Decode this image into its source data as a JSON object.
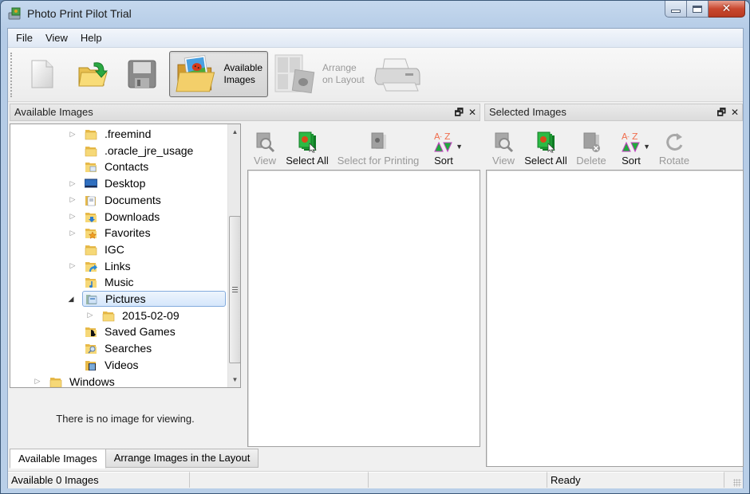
{
  "window": {
    "title": "Photo Print Pilot Trial",
    "controls": {
      "minimize": "minimize",
      "maximize": "maximize",
      "close": "✕"
    }
  },
  "menu": {
    "items": [
      "File",
      "View",
      "Help"
    ]
  },
  "toolbar": {
    "buttons": [
      {
        "id": "new",
        "icon": "new-document-icon",
        "label": ""
      },
      {
        "id": "open",
        "icon": "open-folder-icon",
        "label": ""
      },
      {
        "id": "save",
        "icon": "floppy-disk-icon",
        "label": ""
      },
      {
        "id": "available-images",
        "icon": "folder-image-icon",
        "label_line1": "Available",
        "label_line2": "Images",
        "pressed": true
      },
      {
        "id": "arrange-on-layout",
        "icon": "layout-icon",
        "label_line1": "Arrange",
        "label_line2": "on Layout",
        "disabled": true
      },
      {
        "id": "print",
        "icon": "printer-icon",
        "label": "",
        "disabled": true
      }
    ]
  },
  "available_pane": {
    "title": "Available Images",
    "float_glyph": "🗗",
    "close_glyph": "✕",
    "tree": [
      {
        "label": ".freemind",
        "level": 2,
        "expander": "closed",
        "icon": "folder"
      },
      {
        "label": ".oracle_jre_usage",
        "level": 2,
        "expander": "none",
        "icon": "folder"
      },
      {
        "label": "Contacts",
        "level": 2,
        "expander": "none",
        "icon": "contacts"
      },
      {
        "label": "Desktop",
        "level": 2,
        "expander": "closed",
        "icon": "desktop"
      },
      {
        "label": "Documents",
        "level": 2,
        "expander": "closed",
        "icon": "documents"
      },
      {
        "label": "Downloads",
        "level": 2,
        "expander": "closed",
        "icon": "downloads"
      },
      {
        "label": "Favorites",
        "level": 2,
        "expander": "closed",
        "icon": "favorites"
      },
      {
        "label": "IGC",
        "level": 2,
        "expander": "none",
        "icon": "folder"
      },
      {
        "label": "Links",
        "level": 2,
        "expander": "closed",
        "icon": "links"
      },
      {
        "label": "Music",
        "level": 2,
        "expander": "none",
        "icon": "music"
      },
      {
        "label": "Pictures",
        "level": 2,
        "expander": "open",
        "icon": "pictures",
        "selected": true
      },
      {
        "label": "2015-02-09",
        "level": 3,
        "expander": "closed",
        "icon": "folder"
      },
      {
        "label": "Saved Games",
        "level": 2,
        "expander": "none",
        "icon": "saved-games"
      },
      {
        "label": "Searches",
        "level": 2,
        "expander": "none",
        "icon": "searches"
      },
      {
        "label": "Videos",
        "level": 2,
        "expander": "none",
        "icon": "videos"
      },
      {
        "label": "Windows",
        "level": 0,
        "expander": "closed",
        "icon": "folder"
      }
    ],
    "preview_message": "There is no image for viewing.",
    "tabs": [
      "Available Images",
      "Arrange Images in the Layout"
    ],
    "active_tab": 0
  },
  "middle_pane": {
    "buttons": [
      {
        "label": "View",
        "icon": "view-magnifier-icon",
        "disabled": true
      },
      {
        "label": "Select All",
        "icon": "select-all-icon",
        "disabled": false
      },
      {
        "label": "Select for Printing",
        "icon": "select-for-printing-icon",
        "disabled": true
      },
      {
        "label": "Sort",
        "icon": "sort-az-icon",
        "disabled": false,
        "dropdown": true
      }
    ]
  },
  "selected_pane": {
    "title": "Selected Images",
    "float_glyph": "🗗",
    "close_glyph": "✕",
    "buttons": [
      {
        "label": "View",
        "icon": "view-magnifier-icon",
        "disabled": true
      },
      {
        "label": "Select All",
        "icon": "select-all-icon",
        "disabled": false
      },
      {
        "label": "Delete",
        "icon": "delete-icon",
        "disabled": true
      },
      {
        "label": "Sort",
        "icon": "sort-az-icon",
        "disabled": false,
        "dropdown": true
      },
      {
        "label": "Rotate",
        "icon": "rotate-icon",
        "disabled": true
      }
    ]
  },
  "statusbar": {
    "cells": [
      "Available 0 Images",
      "",
      "",
      "Ready"
    ]
  },
  "colors": {
    "selection_border": "#84acdd",
    "selection_fill": "#d5e6fb",
    "close_button": "#c9482f",
    "disabled_text": "#999999",
    "sort_letters": "#f07050",
    "sort_triangle": "#1faa3c"
  }
}
